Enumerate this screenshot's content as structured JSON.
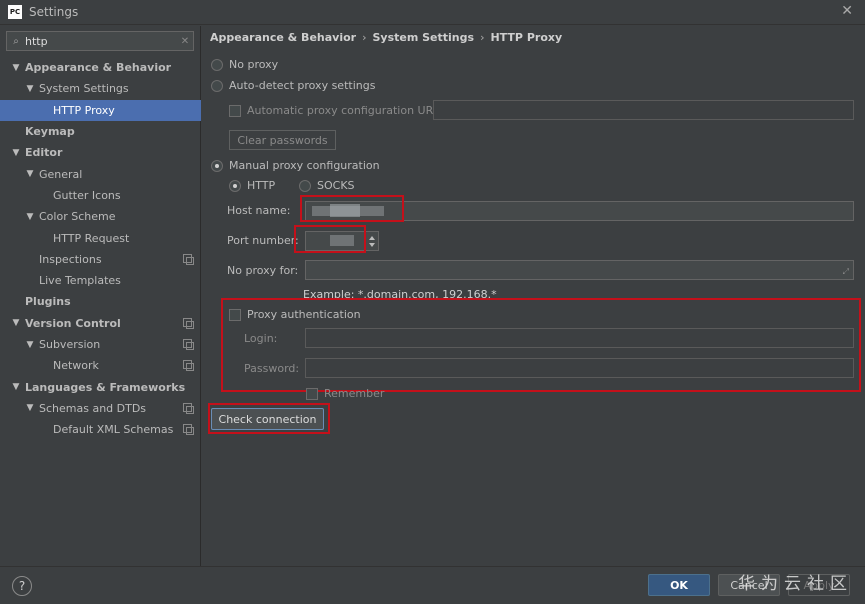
{
  "window": {
    "title": "Settings",
    "app_icon": "PC"
  },
  "search": {
    "value": "http"
  },
  "tree": [
    {
      "label": "Appearance & Behavior",
      "bold": true,
      "arrow": "▼",
      "indent": 0,
      "name": "tree-appearance-behavior"
    },
    {
      "label": "System Settings",
      "arrow": "▼",
      "indent": 1,
      "name": "tree-system-settings"
    },
    {
      "label": "HTTP Proxy",
      "indent": 2,
      "selected": true,
      "name": "tree-http-proxy"
    },
    {
      "label": "Keymap",
      "bold": true,
      "indent": 0,
      "name": "tree-keymap"
    },
    {
      "label": "Editor",
      "bold": true,
      "arrow": "▼",
      "indent": 0,
      "name": "tree-editor"
    },
    {
      "label": "General",
      "arrow": "▼",
      "indent": 1,
      "name": "tree-general"
    },
    {
      "label": "Gutter Icons",
      "indent": 2,
      "name": "tree-gutter-icons"
    },
    {
      "label": "Color Scheme",
      "arrow": "▼",
      "indent": 1,
      "name": "tree-color-scheme"
    },
    {
      "label": "HTTP Request",
      "indent": 2,
      "name": "tree-http-request"
    },
    {
      "label": "Inspections",
      "indent": 1,
      "cfg": true,
      "name": "tree-inspections"
    },
    {
      "label": "Live Templates",
      "indent": 1,
      "name": "tree-live-templates"
    },
    {
      "label": "Plugins",
      "bold": true,
      "indent": 0,
      "name": "tree-plugins"
    },
    {
      "label": "Version Control",
      "bold": true,
      "arrow": "▼",
      "indent": 0,
      "cfg": true,
      "name": "tree-version-control"
    },
    {
      "label": "Subversion",
      "arrow": "▼",
      "indent": 1,
      "cfg": true,
      "name": "tree-subversion"
    },
    {
      "label": "Network",
      "indent": 2,
      "cfg": true,
      "name": "tree-network"
    },
    {
      "label": "Languages & Frameworks",
      "bold": true,
      "arrow": "▼",
      "indent": 0,
      "name": "tree-languages-frameworks"
    },
    {
      "label": "Schemas and DTDs",
      "arrow": "▼",
      "indent": 1,
      "cfg": true,
      "name": "tree-schemas-dtds"
    },
    {
      "label": "Default XML Schemas",
      "indent": 2,
      "cfg": true,
      "name": "tree-default-xml-schemas"
    }
  ],
  "breadcrumb": [
    "Appearance & Behavior",
    "System Settings",
    "HTTP Proxy"
  ],
  "breadcrumb_sep": "›",
  "proxy": {
    "no_proxy": "No proxy",
    "auto_detect": "Auto-detect proxy settings",
    "auto_config_url": "Automatic proxy configuration URL:",
    "clear_passwords": "Clear passwords",
    "manual": "Manual proxy configuration",
    "http": "HTTP",
    "socks": "SOCKS",
    "host_label": "Host name:",
    "port_label": "Port number:",
    "no_proxy_for_label": "No proxy for:",
    "example": "Example: *.domain.com, 192.168.*",
    "proxy_auth": "Proxy authentication",
    "login_label": "Login:",
    "password_label": "Password:",
    "remember": "Remember",
    "check_connection": "Check connection"
  },
  "footer": {
    "help": "?",
    "ok": "OK",
    "cancel": "Cancel",
    "apply": "Apply",
    "watermark": "华为云社区"
  },
  "colors": {
    "background": "#3c3f41",
    "selection": "#4b6eaf",
    "highlight_box": "#c4101a",
    "ok_button": "#365880"
  },
  "icons": {
    "search": "search-icon",
    "clear": "clear-search-icon",
    "close": "close-icon",
    "expand": "expand-field-icon",
    "settings_cfg": "project-config-icon",
    "help": "help-icon"
  }
}
